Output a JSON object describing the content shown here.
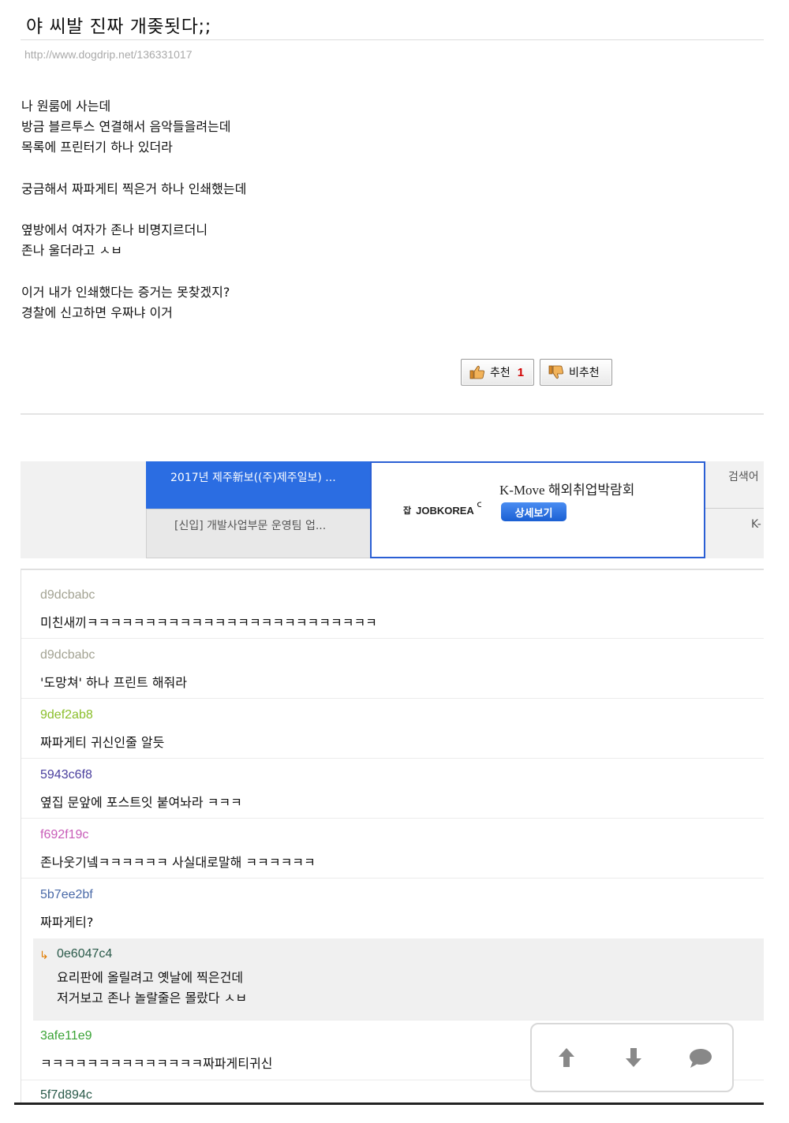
{
  "post": {
    "title": "야 씨발 진짜 개좆됫다;;",
    "url": "http://www.dogdrip.net/136331017",
    "lines": [
      "나 원룸에 사는데",
      "방금 블르투스 연결해서 음악들을려는데",
      "목록에 프린터기 하나 있더라",
      "",
      "궁금해서 짜파게티 찍은거 하나 인쇄했는데",
      "",
      "옆방에서 여자가 존나 비명지르더니",
      "존나 울더라고 ㅅㅂ",
      "",
      "이거 내가 인쇄했다는 증거는 못찾겠지?",
      "경찰에 신고하면 우짜냐 이거"
    ]
  },
  "votes": {
    "up_label": "추천",
    "up_count": "1",
    "down_label": "비추천",
    "up_icon": "thumbs-up-icon",
    "down_icon": "thumbs-down-icon"
  },
  "ad": {
    "job1": "2017년 제주新보((주)제주일보) ...",
    "job2": "[신입] 개발사업부문 운영팀 업...",
    "logo": "JOBKOREA",
    "headline": "K-Move 해외취업박람회",
    "more_button": "상세보기",
    "right_top": "검색어",
    "right_bottom": "K-"
  },
  "comments": [
    {
      "author": "d9dcbabc",
      "color": "#a3a393",
      "lines": [
        "미친새끼ㅋㅋㅋㅋㅋㅋㅋㅋㅋㅋㅋㅋㅋㅋㅋㅋㅋㅋㅋㅋㅋㅋㅋㅋㅋ"
      ]
    },
    {
      "author": "d9dcbabc",
      "color": "#a3a393",
      "lines": [
        "'도망쳐' 하나 프린트 해줘라"
      ]
    },
    {
      "author": "9def2ab8",
      "color": "#8bbf2b",
      "lines": [
        "짜파게티 귀신인줄 알듯"
      ]
    },
    {
      "author": "5943c6f8",
      "color": "#4a3f9e",
      "lines": [
        "옆집 문앞에 포스트잇 붙여놔라 ㅋㅋㅋ"
      ]
    },
    {
      "author": "f692f19c",
      "color": "#c85cb8",
      "lines": [
        "존나웃기넼ㅋㅋㅋㅋㅋㅋ 사실대로말해 ㅋㅋㅋㅋㅋㅋ"
      ]
    },
    {
      "author": "5b7ee2bf",
      "color": "#4a6aa8",
      "lines": [
        "짜파게티?"
      ]
    },
    {
      "author": "0e6047c4",
      "color": "#2a5a4a",
      "reply": true,
      "lines": [
        "요리판에 올릴려고 옛날에 찍은건데",
        "저거보고 존나 놀랄줄은 몰랐다 ㅅㅂ"
      ]
    },
    {
      "author": "3afe11e9",
      "color": "#3aa335",
      "lines": [
        "ㅋㅋㅋㅋㅋㅋㅋㅋㅋㅋㅋㅋㅋㅋ짜파게티귀신"
      ]
    },
    {
      "author": "5f7d894c",
      "color": "#2a5a4a",
      "lines": [
        ""
      ]
    }
  ],
  "float_bar": {
    "up_icon": "arrow-up-icon",
    "down_icon": "arrow-down-icon",
    "comment_icon": "speech-bubble-icon"
  }
}
